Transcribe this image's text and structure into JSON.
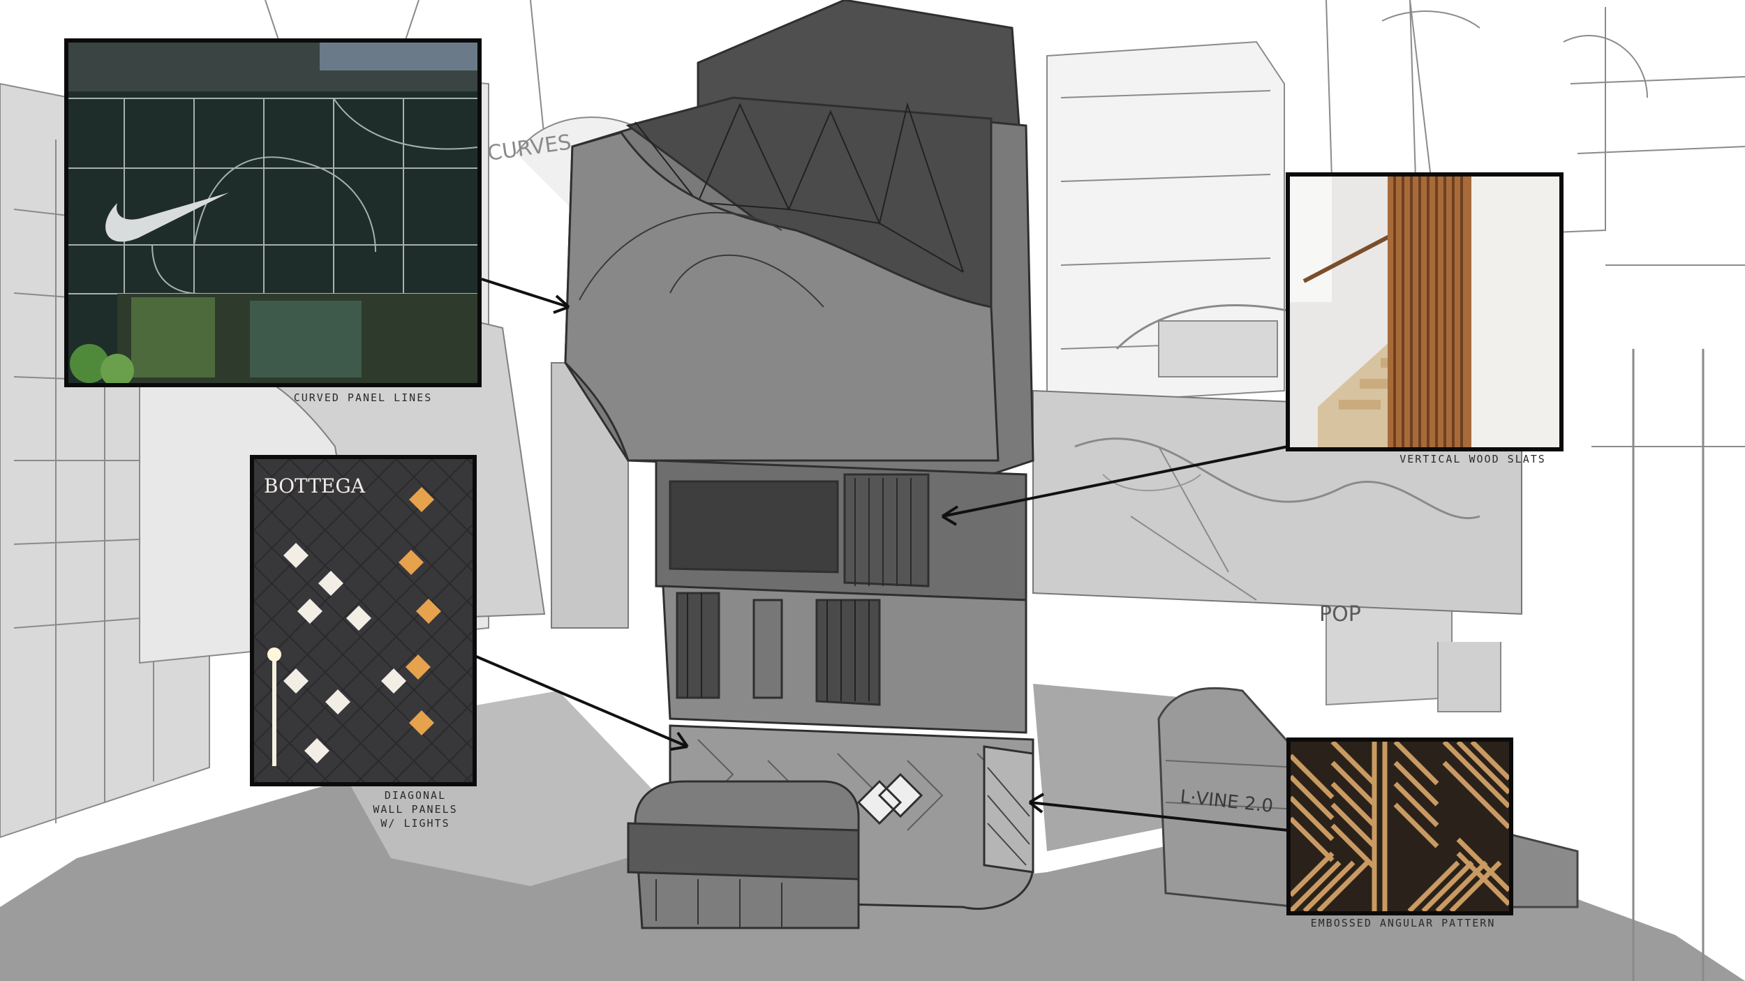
{
  "annotations": {
    "curved": {
      "caption": "CURVED PANEL LINES",
      "brand_mark": "swoosh-logo-icon"
    },
    "diagonal": {
      "caption_lines": [
        "DIAGONAL",
        "WALL PANELS",
        "W/ LIGHTS"
      ],
      "sign": "BOTTEGA"
    },
    "wood": {
      "caption": "VERTICAL WOOD SLATS"
    },
    "angular": {
      "caption": "EMBOSSED ANGULAR PATTERN"
    }
  },
  "sketch_signs": {
    "left_building": "CURVES",
    "mural": "POP",
    "kiosk": "L·VINE 2.0"
  },
  "colors": {
    "paper": "#ffffff",
    "line": "#555555",
    "facade_dark": "#5f5f5f",
    "facade_mid": "#8f8f8f",
    "shadow": "#9a9a9a",
    "wood": "#b27a45"
  }
}
